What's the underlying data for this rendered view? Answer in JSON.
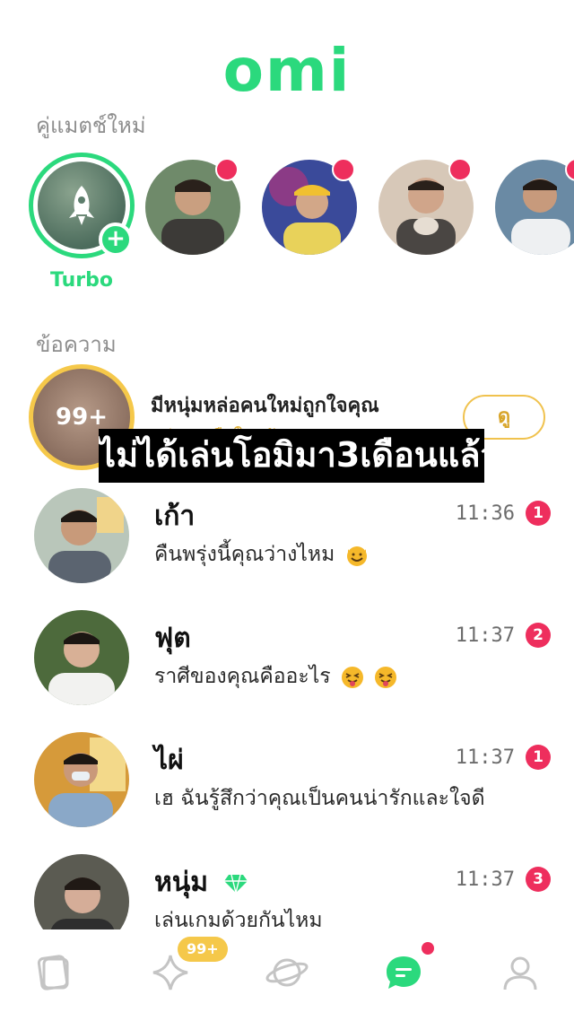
{
  "app": {
    "logo_text": "omi"
  },
  "new_matches": {
    "title": "คู่แมตช์ใหม่",
    "turbo_label": "Turbo",
    "turbo_plus": "+"
  },
  "messages": {
    "title": "ข้อความ",
    "promo": {
      "count": "99+",
      "title": "มีหนุ่มหล่อคนใหม่ถูกใจคุณ",
      "subtitle": "ดูว่าเขาคือใครกัน",
      "button_label": "ดู"
    },
    "chats": [
      {
        "name": "เก้า",
        "preview": "คืนพรุ่งนี้คุณว่างไหม",
        "time": "11:36",
        "unread": "1",
        "emoji": "cat-grin"
      },
      {
        "name": "ฟุต",
        "preview": "ราศีของคุณคืออะไร",
        "time": "11:37",
        "unread": "2",
        "emoji": "squint-tongue"
      },
      {
        "name": "ไผ่",
        "preview": "เฮ ฉันรู้สึกว่าคุณเป็นคนน่ารักและใจดี",
        "time": "11:37",
        "unread": "1",
        "emoji": ""
      },
      {
        "name": "หนุ่ม",
        "preview": "เล่นเกมด้วยกันไหม",
        "time": "11:37",
        "unread": "3",
        "emoji": "",
        "verified_icon": "diamond-icon"
      }
    ]
  },
  "overlay_caption": "ไม่ได้เล่นโอมิมา3เดือนแล้ว",
  "bottom_nav": {
    "items": [
      "cards-icon",
      "sparkle-icon",
      "planet-icon",
      "chat-icon",
      "profile-icon"
    ],
    "sparkle_badge": "99+",
    "active": "chat-icon"
  },
  "colors": {
    "brand_green": "#2bd97d",
    "badge_red": "#ee2e5d",
    "gold": "#f5c84a"
  }
}
